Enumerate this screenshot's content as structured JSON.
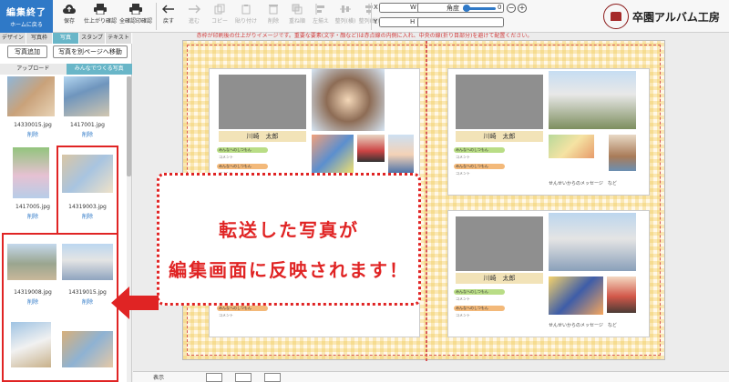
{
  "toolbar": {
    "finish_label": "編集終了",
    "finish_sub": "ホームに戻る",
    "buttons": [
      {
        "label": "保存",
        "icon": "cloud-upload-icon",
        "enabled": true
      },
      {
        "label": "仕上がり確認",
        "icon": "printer-icon",
        "enabled": true
      },
      {
        "label": "全確認印確認",
        "icon": "printer-icon",
        "enabled": true
      },
      {
        "label": "戻す",
        "icon": "undo-arrow-icon",
        "enabled": true
      },
      {
        "label": "進む",
        "icon": "redo-arrow-icon",
        "enabled": false
      },
      {
        "label": "コピー",
        "icon": "copy-icon",
        "enabled": false
      },
      {
        "label": "貼り付け",
        "icon": "paste-icon",
        "enabled": false
      },
      {
        "label": "削除",
        "icon": "trash-icon",
        "enabled": false
      },
      {
        "label": "重ね順",
        "icon": "layers-icon",
        "enabled": false
      },
      {
        "label": "左揃え",
        "icon": "align-left-icon",
        "enabled": false
      },
      {
        "label": "整列(横)",
        "icon": "align-horizontal-icon",
        "enabled": false
      },
      {
        "label": "整列(縦)",
        "icon": "align-vertical-icon",
        "enabled": false
      }
    ],
    "x_label": "X",
    "y_label": "Y",
    "w_label": "W",
    "h_label": "H",
    "angle_label": "角度",
    "angle_value": "0",
    "zoom_minus": "−",
    "zoom_plus": "+",
    "brand": "卒園アルバム工房"
  },
  "left_panel": {
    "tabs": [
      "デザイン",
      "写真枠",
      "写真",
      "スタンプ",
      "テキスト"
    ],
    "active_tab": 2,
    "add_photo_label": "写真追加",
    "move_photo_label": "写真を別ページへ移動",
    "subtabs": [
      "アップロード",
      "みんなでつくる写真"
    ],
    "active_subtab": 1,
    "thumbnails": [
      {
        "file": "14330015.jpg",
        "delete": "削除"
      },
      {
        "file": "1417001.jpg",
        "delete": "削除"
      },
      {
        "file": "1417005.jpg",
        "delete": "削除"
      },
      {
        "file": "14319003.jpg",
        "delete": "削除"
      },
      {
        "file": "14319008.jpg",
        "delete": "削除"
      },
      {
        "file": "14319015.jpg",
        "delete": "削除"
      },
      {
        "file": "",
        "delete": ""
      },
      {
        "file": "",
        "delete": ""
      }
    ]
  },
  "canvas": {
    "notice": "赤枠が印刷後の仕上がりイメージです。重要な要素(文字・顔など)は赤点線の内側に入れ、中央の線(折り目部分)を避けて配置ください。",
    "pages": [
      {
        "name": "川崎　太郎",
        "pill1": "みんなへのしつもん",
        "pill2": "みんなへのしつもん",
        "comment": "コメント",
        "message": ""
      },
      {
        "name": "川崎　太郎",
        "pill1": "みんなへのしつもん",
        "pill2": "みんなへのしつもん",
        "comment": "コメント",
        "message": "せんせいからのメッセージ　など"
      },
      {
        "name": "",
        "pill1": "みんなへのしつもん",
        "pill2": "みんなへのしつもん",
        "comment": "コメント",
        "message": ""
      },
      {
        "name": "川崎　太郎",
        "pill1": "みんなへのしつもん",
        "pill2": "みんなへのしつもん",
        "comment": "コメント",
        "message": "せんせいからのメッセージ　など"
      }
    ]
  },
  "callout": {
    "line1": "転送した写真が",
    "line2": "編集画面に反映されます！"
  },
  "bottom": {
    "view_label": "表示"
  },
  "colors": {
    "accent": "#2f79c7",
    "tab_active": "#69b6c8",
    "callout": "#e02424"
  }
}
